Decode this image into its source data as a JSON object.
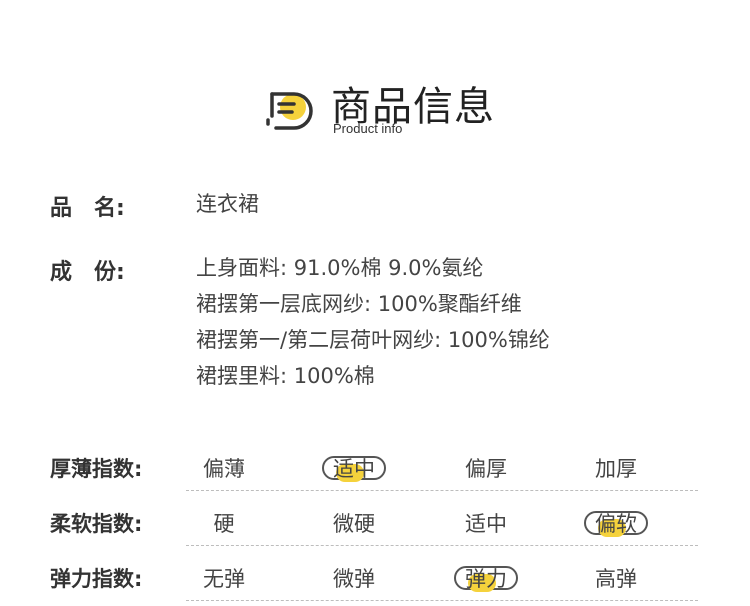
{
  "header": {
    "title_cn": "商品信息",
    "title_en": "Product info",
    "logo_icon": "document-list-icon",
    "accent_color": "#f5d23c"
  },
  "info": {
    "name_label": "品　名:",
    "name_value": "连衣裙",
    "material_label": "成　份:",
    "material_lines": [
      "上身面料: 91.0%棉 9.0%氨纶",
      "裙摆第一层底网纱: 100%聚酯纤维",
      "裙摆第一/第二层荷叶网纱: 100%锦纶",
      "裙摆里料: 100%棉"
    ]
  },
  "indices": [
    {
      "label": "厚薄指数:",
      "options": [
        "偏薄",
        "适中",
        "偏厚",
        "加厚"
      ],
      "selected": "适中"
    },
    {
      "label": "柔软指数:",
      "options": [
        "硬",
        "微硬",
        "适中",
        "偏软"
      ],
      "selected": "偏软"
    },
    {
      "label": "弹力指数:",
      "options": [
        "无弹",
        "微弹",
        "弹力",
        "高弹"
      ],
      "selected": "弹力"
    }
  ]
}
